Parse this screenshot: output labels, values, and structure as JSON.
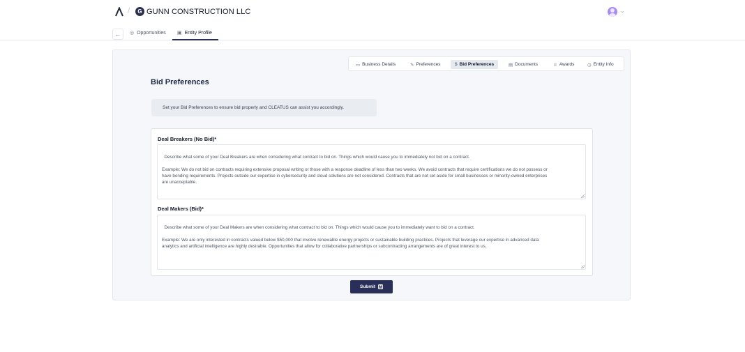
{
  "header": {
    "logo_icon": "cleatus-logo-icon",
    "separator": "/",
    "company_initial": "G",
    "company_name": "GUNN CONSTRUCTION LLC"
  },
  "nav": {
    "back": "←",
    "tabs": [
      {
        "label": "Opportunities",
        "icon": "target-icon",
        "glyph": "◎"
      },
      {
        "label": "Entity Profile",
        "icon": "id-card-icon",
        "glyph": "▣"
      }
    ]
  },
  "subtabs": [
    {
      "label": "Business Details",
      "glyph": "▭"
    },
    {
      "label": "Preferences",
      "glyph": "✎"
    },
    {
      "label": "Bid Preferences",
      "glyph": "$"
    },
    {
      "label": "Documents",
      "glyph": "▤"
    },
    {
      "label": "Awards",
      "glyph": "♕"
    },
    {
      "label": "Entity Info",
      "glyph": "◷"
    }
  ],
  "page": {
    "title": "Bid Preferences",
    "info": "Set your Bid Preferences to ensure bid properly and CLEATUS can assist you accordingly."
  },
  "form": {
    "deal_breakers_label": "Deal Breakers (No Bid)",
    "deal_breakers_placeholder": "Describe what some of your Deal Breakers are when considering what contract to bid on. Things which would cause you to immediately not bid on a contract.\n\nExample: We do not bid on contracts requiring extensive proposal writing or those with a response deadline of less than two weeks. We avoid contracts that require certifications we do not possess or\nhave bonding requirements. Projects outside our expertise in cybersecurity and cloud solutions are not considered. Contracts that are not set aside for small businesses or minority-owned enterprises\nare unacceptable.",
    "deal_makers_label": "Deal Makers (Bid)",
    "deal_makers_placeholder": "Describe what some of your Deal Makers are when considering what contract to bid on. Things which would cause you to immediately want to bid on a contract.\n\nExample: We are only interested in contracts valued below $50,000 that involve renewable energy projects or sustainable building practices. Projects that leverage our expertise in advanced data\nanalytics and artificial intelligence are highly desirable. Opportunities that allow for collaborative partnerships or subcontracting arrangements are of great interest to us.",
    "required_mark": "*",
    "submit_label": "Submit"
  },
  "colors": {
    "primary": "#2a2f5a",
    "panel_bg": "#f5f7fa",
    "avatar": "#a78bfa"
  }
}
